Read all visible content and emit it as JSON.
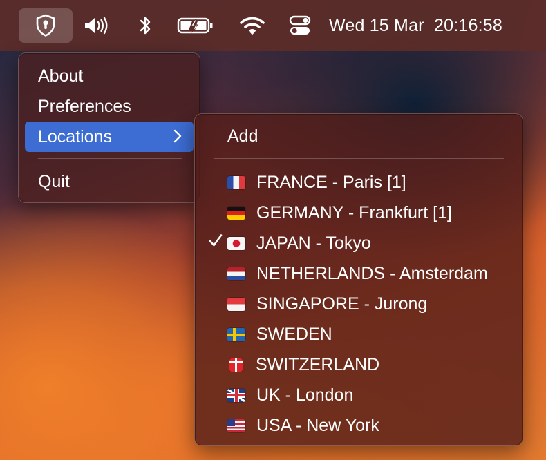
{
  "menubar": {
    "icons": [
      "vpn-shield-icon",
      "volume-icon",
      "bluetooth-icon",
      "battery-charging-icon",
      "wifi-icon",
      "control-center-icon"
    ],
    "date": "Wed 15 Mar",
    "time": "20:16:58"
  },
  "app_menu": {
    "items": [
      {
        "label": "About"
      },
      {
        "label": "Preferences"
      },
      {
        "label": "Locations",
        "has_submenu": true,
        "highlighted": true
      },
      {
        "label": "Quit"
      }
    ]
  },
  "locations_menu": {
    "add_label": "Add",
    "items": [
      {
        "flag": "france-flag-icon",
        "label": "FRANCE - Paris [1]",
        "checked": false
      },
      {
        "flag": "germany-flag-icon",
        "label": "GERMANY - Frankfurt [1]",
        "checked": false
      },
      {
        "flag": "japan-flag-icon",
        "label": "JAPAN - Tokyo",
        "checked": true
      },
      {
        "flag": "netherlands-flag-icon",
        "label": "NETHERLANDS - Amsterdam",
        "checked": false
      },
      {
        "flag": "singapore-flag-icon",
        "label": "SINGAPORE - Jurong",
        "checked": false
      },
      {
        "flag": "sweden-flag-icon",
        "label": "SWEDEN",
        "checked": false
      },
      {
        "flag": "switzerland-flag-icon",
        "label": "SWITZERLAND",
        "checked": false
      },
      {
        "flag": "uk-flag-icon",
        "label": "UK - London",
        "checked": false
      },
      {
        "flag": "usa-flag-icon",
        "label": "USA - New York",
        "checked": false
      }
    ]
  },
  "colors": {
    "menu_highlight": "#3d6cd2",
    "menubar": "#5c2c28"
  }
}
